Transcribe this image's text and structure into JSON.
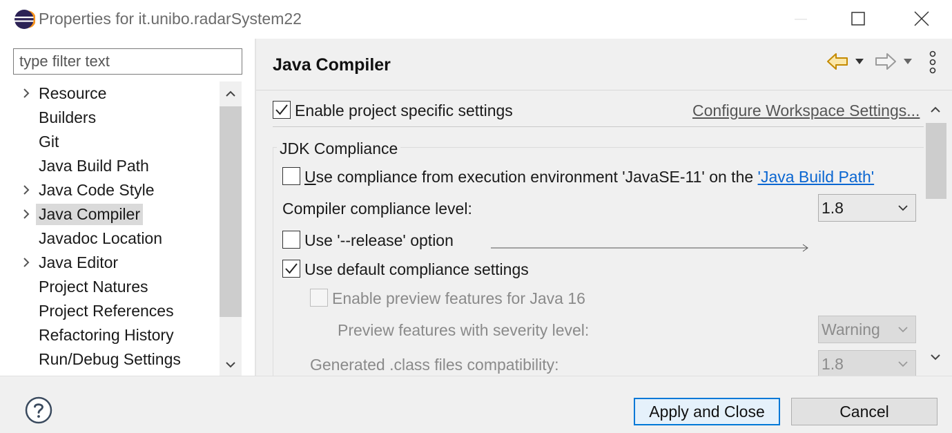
{
  "window": {
    "title": "Properties for it.unibo.radarSystem22"
  },
  "left": {
    "filter_placeholder": "type filter text",
    "tree": [
      {
        "label": "Resource",
        "expandable": true,
        "selected": false
      },
      {
        "label": "Builders",
        "expandable": false,
        "selected": false
      },
      {
        "label": "Git",
        "expandable": false,
        "selected": false
      },
      {
        "label": "Java Build Path",
        "expandable": false,
        "selected": false
      },
      {
        "label": "Java Code Style",
        "expandable": true,
        "selected": false
      },
      {
        "label": "Java Compiler",
        "expandable": true,
        "selected": true
      },
      {
        "label": "Javadoc Location",
        "expandable": false,
        "selected": false
      },
      {
        "label": "Java Editor",
        "expandable": true,
        "selected": false
      },
      {
        "label": "Project Natures",
        "expandable": false,
        "selected": false
      },
      {
        "label": "Project References",
        "expandable": false,
        "selected": false
      },
      {
        "label": "Refactoring History",
        "expandable": false,
        "selected": false
      },
      {
        "label": "Run/Debug Settings",
        "expandable": false,
        "selected": false
      }
    ]
  },
  "page": {
    "title": "Java Compiler",
    "enable_specific": {
      "label": "Enable project specific settings",
      "checked": true
    },
    "configure_link": "Configure Workspace Settings...",
    "group_title": "JDK Compliance",
    "use_ee": {
      "prefix": "se compliance from execution environment 'JavaSE-11' on the ",
      "mnemonic": "U",
      "link": "'Java Build Path'",
      "checked": false
    },
    "compliance_level": {
      "label": "Compiler compliance level:",
      "value": "1.8"
    },
    "release_option": {
      "label": "Use '--release' option",
      "checked": false
    },
    "default_compliance": {
      "label": "Use default compliance settings",
      "checked": true
    },
    "preview_features": {
      "label": "Enable preview features for Java 16",
      "checked": false,
      "enabled": false
    },
    "preview_severity": {
      "label": "Preview features with severity level:",
      "value": "Warning"
    },
    "generated_class": {
      "label": "Generated .class files compatibility:",
      "value": "1.8"
    }
  },
  "buttons": {
    "apply_close": "Apply and Close",
    "cancel": "Cancel"
  },
  "colors": {
    "accent": "#0078d7",
    "link": "#0a66d1",
    "back_arrow": "#d9a21b"
  },
  "icons": {
    "app": "eclipse-logo",
    "help": "question-circle-icon",
    "back": "back-arrow-icon",
    "forward": "forward-arrow-icon",
    "menu": "vertical-ellipsis-icon"
  }
}
